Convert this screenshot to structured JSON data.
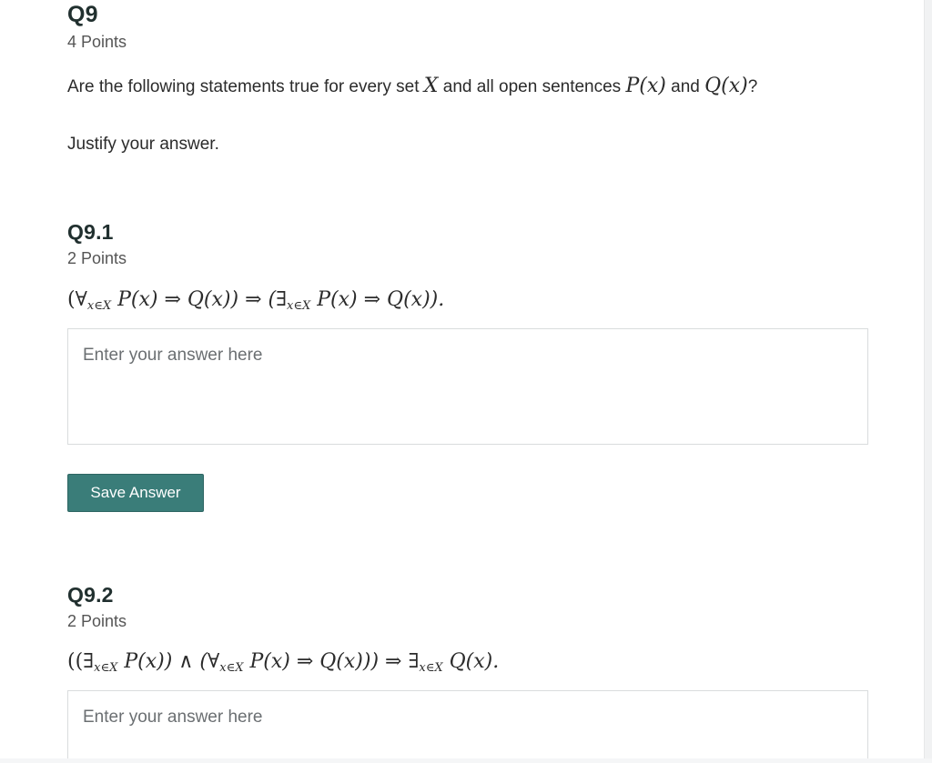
{
  "question": {
    "title": "Q9",
    "points": "4 Points",
    "prompt_before": "Are the following statements true for every set",
    "prompt_set": "X",
    "prompt_middle": "and all open sentences",
    "prompt_p": "P(x)",
    "prompt_and": "and",
    "prompt_q": "Q(x)",
    "prompt_end": "?",
    "justify": "Justify your answer."
  },
  "subquestions": [
    {
      "title": "Q9.1",
      "points": "2 Points",
      "formula": {
        "p1": "(∀",
        "sub1": "x∈X",
        "p2": "P(x) ⇒ Q(x)) ⇒ (∃",
        "sub2": "x∈X",
        "p3": "P(x) ⇒ Q(x))."
      },
      "answer_placeholder": "Enter your answer here",
      "save_label": "Save Answer"
    },
    {
      "title": "Q9.2",
      "points": "2 Points",
      "formula": {
        "p1": "((∃",
        "sub1": "x∈X",
        "p2": "P(x)) ∧ (∀",
        "sub2": "x∈X",
        "p3": "P(x) ⇒ Q(x))) ⇒ ∃",
        "sub3": "x∈X",
        "p4": "Q(x)."
      },
      "answer_placeholder": "Enter your answer here"
    }
  ]
}
